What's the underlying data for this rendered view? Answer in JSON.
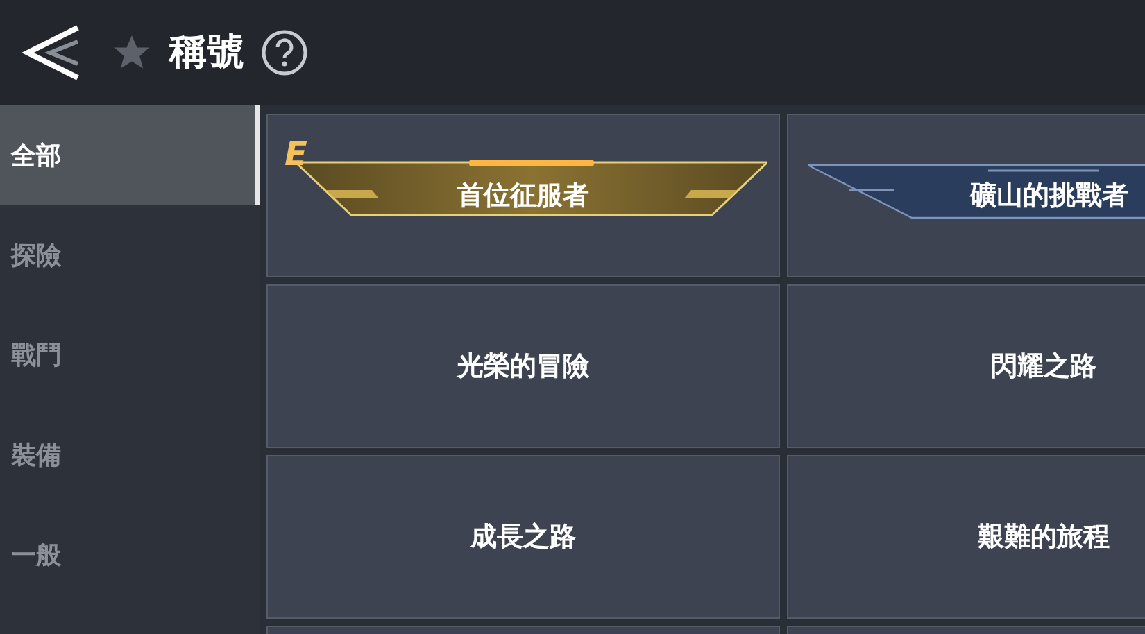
{
  "header": {
    "title": "稱號"
  },
  "sidebar": {
    "items": [
      {
        "label": "全部",
        "selected": true
      },
      {
        "label": "探險",
        "selected": false
      },
      {
        "label": "戰鬥",
        "selected": false
      },
      {
        "label": "裝備",
        "selected": false
      },
      {
        "label": "一般",
        "selected": false
      }
    ]
  },
  "titles": [
    {
      "name": "首位征服者",
      "kind": "gold",
      "rank": "E"
    },
    {
      "name": "礦山的挑戰者",
      "kind": "blue"
    },
    {
      "name": "光榮的冒險",
      "kind": "plain"
    },
    {
      "name": "閃耀之路",
      "kind": "plain"
    },
    {
      "name": "成長之路",
      "kind": "plain"
    },
    {
      "name": "艱難的旅程",
      "kind": "plain"
    }
  ]
}
